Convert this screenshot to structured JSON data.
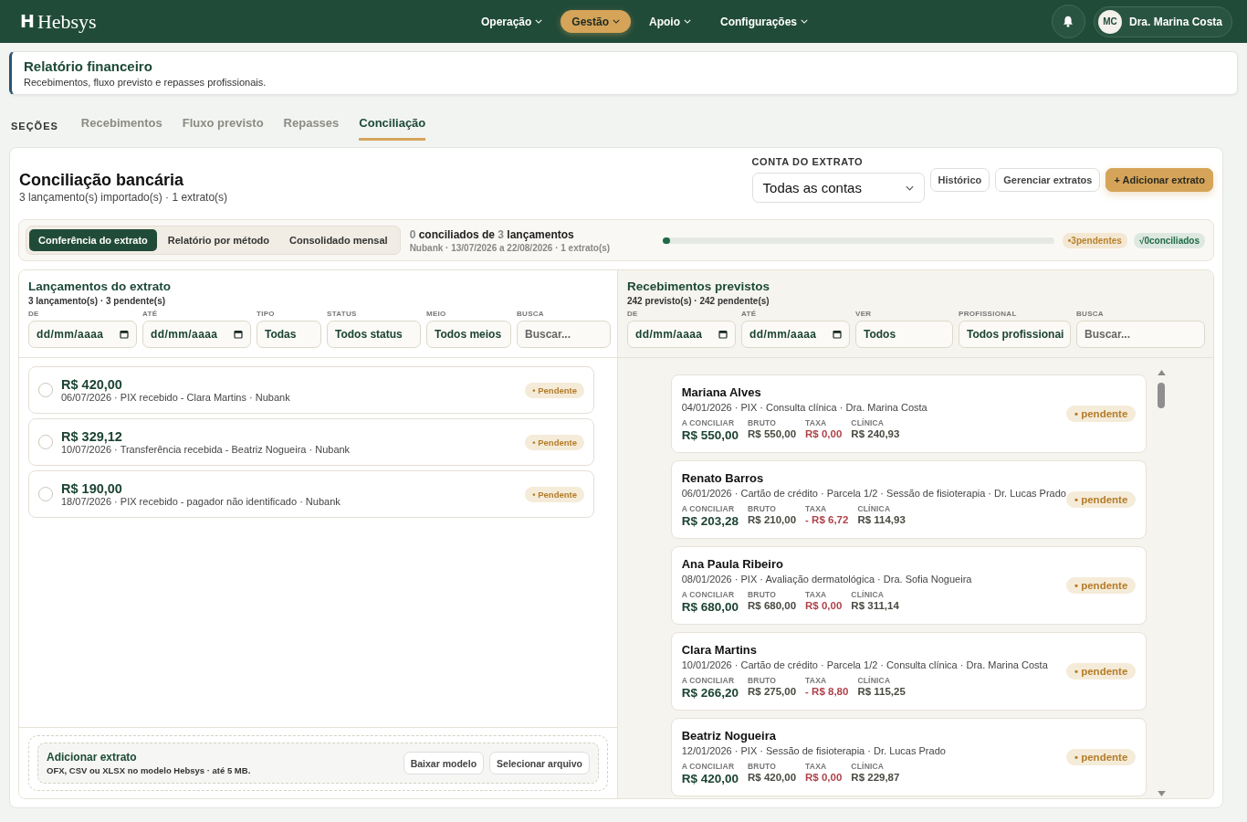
{
  "nav": {
    "logo": {
      "mark": "H",
      "name": "Hebsys"
    },
    "items": [
      {
        "label": "Operação",
        "selected": false
      },
      {
        "label": "Gestão",
        "selected": true
      },
      {
        "label": "Apoio",
        "selected": false
      },
      {
        "label": "Configurações",
        "selected": false
      }
    ],
    "user": {
      "initials": "MC",
      "name": "Dra. Marina Costa"
    }
  },
  "header": {
    "title": "Relatório financeiro",
    "subtitle": "Recebimentos, fluxo previsto e repasses profissionais."
  },
  "sections": {
    "label": "SEÇÕES",
    "tabs": [
      {
        "label": "Recebimentos",
        "selected": false
      },
      {
        "label": "Fluxo previsto",
        "selected": false
      },
      {
        "label": "Repasses",
        "selected": false
      },
      {
        "label": "Conciliação",
        "selected": true
      }
    ]
  },
  "reconciliation": {
    "title": "Conciliação bancária",
    "subtitle": "3 lançamento(s) importado(s) · 1 extrato(s)",
    "account": {
      "label": "CONTA DO EXTRATO",
      "value": "Todas as contas"
    },
    "buttons": [
      {
        "label": "Histórico",
        "kind": "outline"
      },
      {
        "label": "Gerenciar extratos",
        "kind": "outline"
      },
      {
        "label": "+ Adicionar extrato",
        "kind": "primary"
      }
    ],
    "views": [
      {
        "label": "Conferência do extrato",
        "selected": true
      },
      {
        "label": "Relatório por método",
        "selected": false
      },
      {
        "label": "Consolidado mensal",
        "selected": false
      }
    ],
    "summary": {
      "reconciled": "0",
      "reconciled_label": "conciliados de",
      "total": "3",
      "total_label": "lançamentos",
      "details": "Nubank · 13/07/2026 a 22/08/2026 · 1 extrato(s)"
    },
    "progress": {
      "level": 0
    },
    "badges": [
      {
        "text": "•3pendentes",
        "kind": "pending"
      },
      {
        "text": "√0conciliados",
        "kind": "done"
      }
    ]
  },
  "statement": {
    "title": "Lançamentos do extrato",
    "subtitle": "3 lançamento(s) · 3 pendente(s)",
    "filters": [
      {
        "label": "DE",
        "kind": "date",
        "value": "dd/mm/aaaa"
      },
      {
        "label": "ATÉ",
        "kind": "date",
        "value": "dd/mm/aaaa"
      },
      {
        "label": "TIPO",
        "kind": "select",
        "value": "Todas"
      },
      {
        "label": "STATUS",
        "kind": "select",
        "value": "Todos status"
      },
      {
        "label": "MEIO",
        "kind": "select",
        "value": "Todos meios"
      },
      {
        "label": "BUSCA",
        "kind": "search",
        "placeholder": "Buscar..."
      }
    ],
    "entries": [
      {
        "amount": "R$ 420,00",
        "details": "06/07/2026 · PIX recebido - Clara Martins · Nubank",
        "selected": false,
        "status": "• Pendente"
      },
      {
        "amount": "R$ 329,12",
        "details": "10/07/2026 · Transferência recebida - Beatriz Nogueira · Nubank",
        "selected": false,
        "status": "• Pendente"
      },
      {
        "amount": "R$ 190,00",
        "details": "18/07/2026 · PIX recebido - pagador não identificado · Nubank",
        "selected": false,
        "status": "• Pendente"
      }
    ],
    "upload": {
      "title": "Adicionar extrato",
      "hint": "OFX, CSV ou XLSX no modelo Hebsys · até 5 MB.",
      "buttons": [
        "Baixar modelo",
        "Selecionar arquivo"
      ]
    }
  },
  "expected": {
    "title": "Recebimentos previstos",
    "subtitle": "242 previsto(s) · 242 pendente(s)",
    "filters": [
      {
        "label": "DE",
        "kind": "date",
        "value": "dd/mm/aaaa"
      },
      {
        "label": "ATÉ",
        "kind": "date",
        "value": "dd/mm/aaaa"
      },
      {
        "label": "VER",
        "kind": "select",
        "value": "Todos"
      },
      {
        "label": "PROFISSIONAL",
        "kind": "select",
        "value": "Todos profissionai"
      },
      {
        "label": "BUSCA",
        "kind": "search",
        "placeholder": "Buscar..."
      }
    ],
    "items": [
      {
        "name": "Mariana Alves",
        "details": "04/01/2026 · PIX · Consulta clínica · Dra. Marina Costa",
        "status": "• pendente",
        "values": [
          {
            "label": "A CONCILIAR",
            "value": "R$ 550,00",
            "kind": "main"
          },
          {
            "label": "BRUTO",
            "value": "R$ 550,00",
            "kind": "plain"
          },
          {
            "label": "TAXA",
            "value": "R$ 0,00",
            "kind": "fee"
          },
          {
            "label": "CLÍNICA",
            "value": "R$ 240,93",
            "kind": "plain"
          }
        ]
      },
      {
        "name": "Renato Barros",
        "details": "06/01/2026 · Cartão de crédito · Parcela 1/2 · Sessão de fisioterapia · Dr. Lucas Prado",
        "status": "• pendente",
        "values": [
          {
            "label": "A CONCILIAR",
            "value": "R$ 203,28",
            "kind": "main"
          },
          {
            "label": "BRUTO",
            "value": "R$ 210,00",
            "kind": "plain"
          },
          {
            "label": "TAXA",
            "value": "- R$ 6,72",
            "kind": "fee"
          },
          {
            "label": "CLÍNICA",
            "value": "R$ 114,93",
            "kind": "plain"
          }
        ]
      },
      {
        "name": "Ana Paula Ribeiro",
        "details": "08/01/2026 · PIX · Avaliação dermatológica · Dra. Sofia Nogueira",
        "status": "• pendente",
        "values": [
          {
            "label": "A CONCILIAR",
            "value": "R$ 680,00",
            "kind": "main"
          },
          {
            "label": "BRUTO",
            "value": "R$ 680,00",
            "kind": "plain"
          },
          {
            "label": "TAXA",
            "value": "R$ 0,00",
            "kind": "fee"
          },
          {
            "label": "CLÍNICA",
            "value": "R$ 311,14",
            "kind": "plain"
          }
        ]
      },
      {
        "name": "Clara Martins",
        "details": "10/01/2026 · Cartão de crédito · Parcela 1/2 · Consulta clínica · Dra. Marina Costa",
        "status": "• pendente",
        "values": [
          {
            "label": "A CONCILIAR",
            "value": "R$ 266,20",
            "kind": "main"
          },
          {
            "label": "BRUTO",
            "value": "R$ 275,00",
            "kind": "plain"
          },
          {
            "label": "TAXA",
            "value": "- R$ 8,80",
            "kind": "fee"
          },
          {
            "label": "CLÍNICA",
            "value": "R$ 115,25",
            "kind": "plain"
          }
        ]
      },
      {
        "name": "Beatriz Nogueira",
        "details": "12/01/2026 · PIX · Sessão de fisioterapia · Dr. Lucas Prado",
        "status": "• pendente",
        "values": [
          {
            "label": "A CONCILIAR",
            "value": "R$ 420,00",
            "kind": "main"
          },
          {
            "label": "BRUTO",
            "value": "R$ 420,00",
            "kind": "plain"
          },
          {
            "label": "TAXA",
            "value": "R$ 0,00",
            "kind": "fee"
          },
          {
            "label": "CLÍNICA",
            "value": "R$ 229,87",
            "kind": "plain"
          }
        ]
      }
    ]
  }
}
